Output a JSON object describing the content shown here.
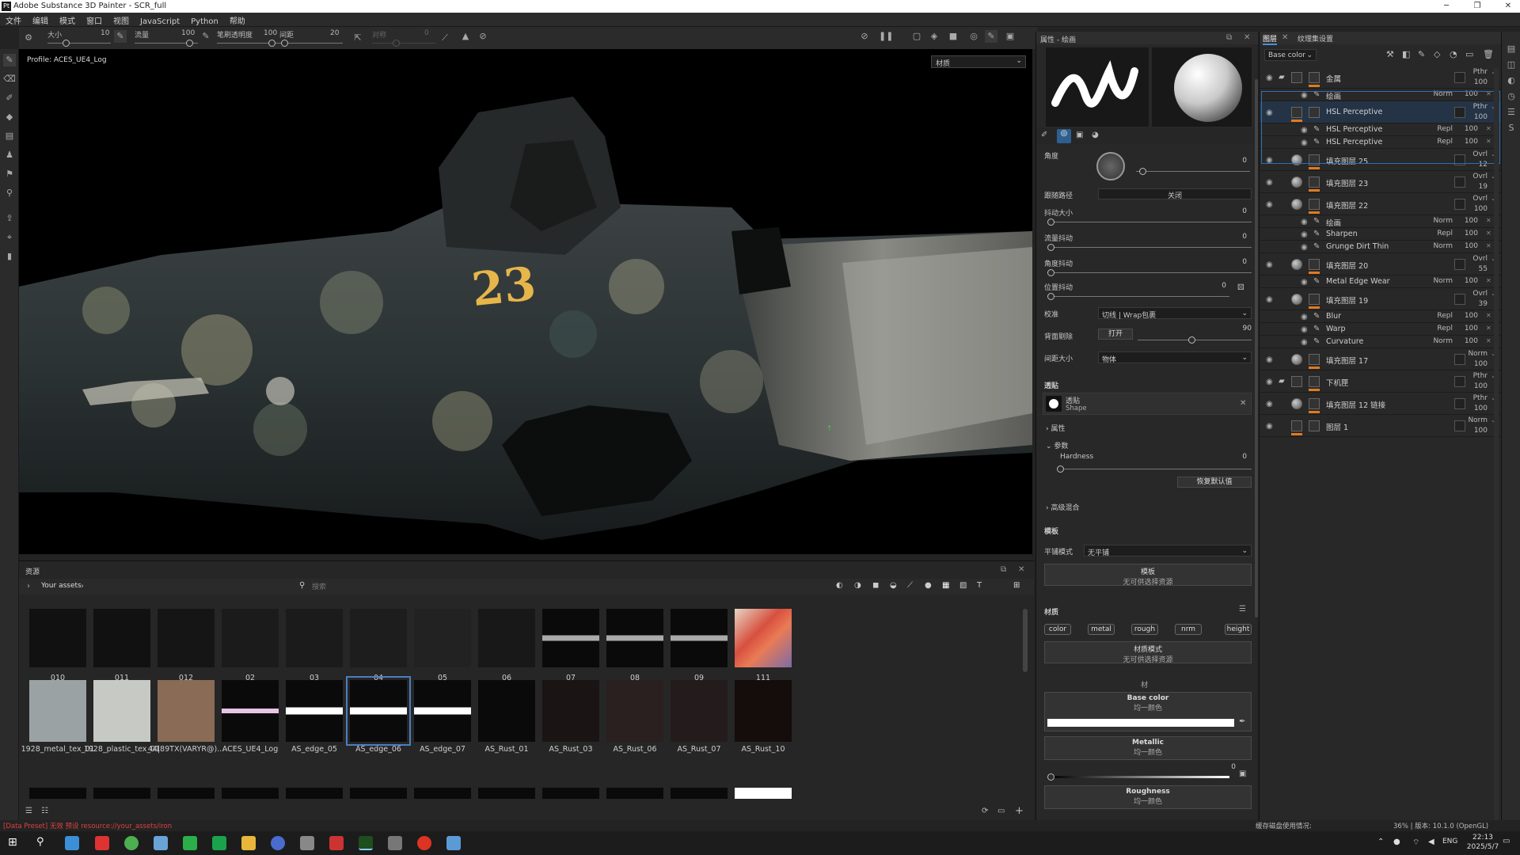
{
  "app": {
    "title": "Adobe Substance 3D Painter - SCR_full",
    "logo": "Pt"
  },
  "menu": [
    "文件",
    "编辑",
    "模式",
    "窗口",
    "视图",
    "JavaScript",
    "Python",
    "帮助"
  ],
  "toolopts": {
    "size_label": "大小",
    "size_value": "10",
    "flow_label": "流量",
    "flow_value": "100",
    "stroke_opacity_label": "笔刷透明度",
    "stroke_opacity_value": "100",
    "spacing_label": "间距",
    "spacing_value": "20",
    "sym_label": "对称",
    "sym_value": "0"
  },
  "viewport": {
    "profile": "Profile: ACES_UE4_Log",
    "mode": "材质",
    "decal": "23"
  },
  "assets": {
    "title": "资源",
    "breadcrumb": "Your assets",
    "search_placeholder": "搜索",
    "row1": [
      "010",
      "011",
      "012",
      "02",
      "03",
      "04",
      "05",
      "06",
      "07",
      "08",
      "09",
      "111"
    ],
    "row2": [
      "1928_metal_tex_01",
      "1928_plastic_tex_01",
      "44|89TX(VARYR@)...",
      "ACES_UE4_Log",
      "AS_edge_05",
      "AS_edge_06",
      "AS_edge_07",
      "AS_Rust_01",
      "AS_Rust_03",
      "AS_Rust_06",
      "AS_Rust_07",
      "AS_Rust_10"
    ]
  },
  "props": {
    "title": "属性 - 绘画",
    "angle_label": "角度",
    "angle_value": "0",
    "follow_path_label": "跟随路径",
    "follow_path_value": "关闭",
    "size_jitter_label": "抖动大小",
    "size_jitter_value": "0",
    "flow_jitter_label": "流量抖动",
    "flow_jitter_value": "0",
    "angle_jitter_label": "角度抖动",
    "angle_jitter_value": "0",
    "pos_jitter_label": "位置抖动",
    "pos_jitter_value": "0",
    "alignment_label": "校准",
    "alignment_value": "切线 | Wrap包裹",
    "backface_label": "背面剔除",
    "backface_btn": "打开",
    "backface_value": "90",
    "size_space_label": "间距大小",
    "size_space_value": "物体",
    "alpha_title": "透贴",
    "alpha_name": "透贴",
    "alpha_sub": "Shape",
    "attr_label": "属性",
    "params_label": "参数",
    "hardness_label": "Hardness",
    "hardness_value": "0",
    "reset_btn": "恢复默认值",
    "adv_label": "高级混合",
    "stencil_title": "模板",
    "tiling_label": "平铺模式",
    "tiling_value": "无平铺",
    "stencil_btn": "模板",
    "stencil_sub": "无可供选择资源",
    "material_title": "材质",
    "channels": [
      "color",
      "metal",
      "rough",
      "nrm",
      "height"
    ],
    "material_mode": "材质模式",
    "material_mode_sub": "无可供选择资源",
    "mat_small": "材",
    "base_color": "Base color",
    "uniform": "均一颜色",
    "metallic": "Metallic",
    "metallic_value": "0",
    "roughness": "Roughness"
  },
  "layers": {
    "tab_layers": "图层",
    "tab_texset": "纹理集设置",
    "channel": "Base color",
    "rows": [
      {
        "name": "金属",
        "blend": "Pthr",
        "op": "100",
        "type": "folder",
        "eye": true
      },
      {
        "name": "绘画",
        "blend": "Norm",
        "op": "100",
        "type": "sub"
      },
      {
        "name": "HSL Perceptive",
        "blend": "Pthr",
        "op": "100",
        "type": "paint",
        "eye": true,
        "selected": true
      },
      {
        "name": "HSL Perceptive",
        "blend": "Repl",
        "op": "100",
        "type": "sub2"
      },
      {
        "name": "HSL Perceptive",
        "blend": "Repl",
        "op": "100",
        "type": "sub2"
      },
      {
        "name": "填充图层 25",
        "blend": "Ovrl",
        "op": "12",
        "type": "fill",
        "eye": true
      },
      {
        "name": "填充图层 23",
        "blend": "Ovrl",
        "op": "19",
        "type": "fill",
        "eye": true
      },
      {
        "name": "填充图层 22",
        "blend": "Ovrl",
        "op": "100",
        "type": "fill",
        "eye": true
      },
      {
        "name": "绘画",
        "blend": "Norm",
        "op": "100",
        "type": "sub"
      },
      {
        "name": "Sharpen",
        "blend": "Repl",
        "op": "100",
        "type": "sub"
      },
      {
        "name": "Grunge Dirt Thin",
        "blend": "Norm",
        "op": "100",
        "type": "sub"
      },
      {
        "name": "填充图层 20",
        "blend": "Ovrl",
        "op": "55",
        "type": "fill",
        "eye": true
      },
      {
        "name": "Metal Edge Wear",
        "blend": "Norm",
        "op": "100",
        "type": "sub"
      },
      {
        "name": "填充图层 19",
        "blend": "Ovrl",
        "op": "39",
        "type": "fill",
        "eye": true
      },
      {
        "name": "Blur",
        "blend": "Repl",
        "op": "100",
        "type": "sub"
      },
      {
        "name": "Warp",
        "blend": "Repl",
        "op": "100",
        "type": "sub"
      },
      {
        "name": "Curvature",
        "blend": "Norm",
        "op": "100",
        "type": "sub"
      },
      {
        "name": "填充图层 17",
        "blend": "Norm",
        "op": "100",
        "type": "fill",
        "eye": true
      },
      {
        "name": "下机匣",
        "blend": "Pthr",
        "op": "100",
        "type": "folder",
        "eye": true
      },
      {
        "name": "填充图层 12 链接",
        "blend": "Pthr",
        "op": "100",
        "type": "fill",
        "eye": true
      },
      {
        "name": "图层 1",
        "blend": "Norm",
        "op": "100",
        "type": "paint",
        "eye": true
      }
    ]
  },
  "status": {
    "error": "[Data Preset] 无效 预设 resource://your_assets/iron",
    "right": "缓存磁盘使用情况:",
    "mem": "36% | 版本: 10.1.0 (OpenGL)"
  },
  "taskbar": {
    "lang": "ENG",
    "time": "22:13",
    "date": "2025/5/7"
  },
  "colors": {
    "accent": "#e07a1f",
    "selected": "#2f6fb5",
    "bg": "#282828"
  }
}
